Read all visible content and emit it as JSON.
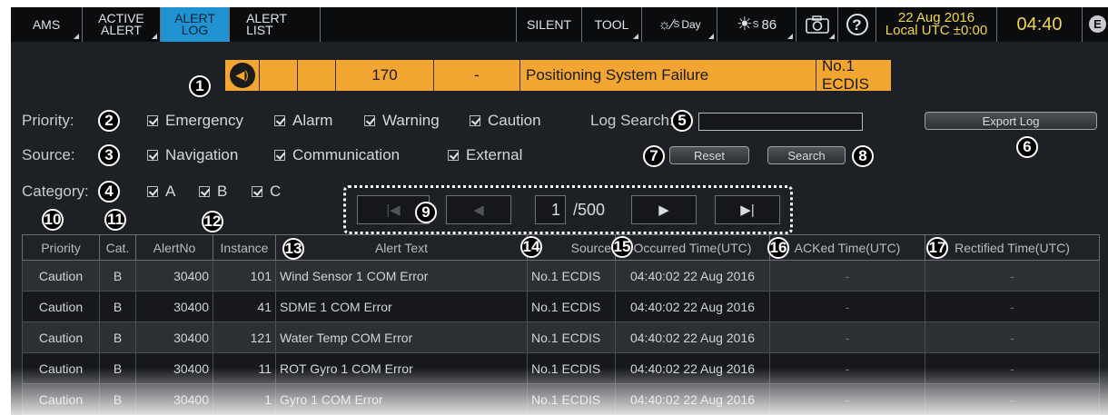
{
  "topbar": {
    "ams": "AMS",
    "active_alert_1": "ACTIVE",
    "active_alert_2": "ALERT",
    "alert_log_1": "ALERT",
    "alert_log_2": "LOG",
    "alert_list_1": "ALERT",
    "alert_list_2": "LIST",
    "silent": "SILENT",
    "tool": "TOOL",
    "day_mode": "Day",
    "day_sub": "S",
    "brightness": "86",
    "brightness_sub": "S",
    "date": "22 Aug 2016",
    "timezone": "Local UTC ±0:00",
    "time": "04:40",
    "emblem": "E",
    "accent_color": "#1e93cf",
    "time_color": "#f2d64b"
  },
  "latest_alert": {
    "alert_no": "170",
    "instance": "-",
    "text": "Positioning System Failure",
    "source": "No.1 ECDIS",
    "color": "#f2a531",
    "icon": "speaker-icon"
  },
  "filters": {
    "priority_label": "Priority:",
    "priority_options": [
      "Emergency",
      "Alarm",
      "Warning",
      "Caution"
    ],
    "source_label": "Source:",
    "source_options": [
      "Navigation",
      "Communication",
      "External"
    ],
    "category_label": "Category:",
    "category_options": [
      "A",
      "B",
      "C"
    ],
    "log_search_label": "Log Search:",
    "log_search_value": "",
    "export_button": "Export Log",
    "reset_button": "Reset",
    "search_button": "Search"
  },
  "pager": {
    "first": "|◀",
    "prev": "◀",
    "page": "1",
    "total": "/500",
    "next": "▶",
    "last": "▶|"
  },
  "table": {
    "headers": [
      "Priority",
      "Cat.",
      "AlertNo",
      "Instance",
      "Alert Text",
      "Source",
      "Occurred Time(UTC)",
      "ACKed Time(UTC)",
      "Rectified Time(UTC)"
    ],
    "rows": [
      [
        "Caution",
        "B",
        "30400",
        "101",
        "Wind Sensor 1 COM Error",
        "No.1 ECDIS",
        "04:40:02 22 Aug 2016",
        "-",
        "-"
      ],
      [
        "Caution",
        "B",
        "30400",
        "41",
        "SDME 1 COM Error",
        "No.1 ECDIS",
        "04:40:02 22 Aug 2016",
        "-",
        "-"
      ],
      [
        "Caution",
        "B",
        "30400",
        "121",
        "Water Temp COM Error",
        "No.1 ECDIS",
        "04:40:02 22 Aug 2016",
        "-",
        "-"
      ],
      [
        "Caution",
        "B",
        "30400",
        "11",
        "ROT Gyro 1 COM Error",
        "No.1 ECDIS",
        "04:40:02 22 Aug 2016",
        "-",
        "-"
      ],
      [
        "Caution",
        "B",
        "30400",
        "1",
        "Gyro 1 COM Error",
        "No.1 ECDIS",
        "04:40:02 22 Aug 2016",
        "-",
        "-"
      ]
    ]
  },
  "callouts": [
    "1",
    "2",
    "3",
    "4",
    "5",
    "6",
    "7",
    "8",
    "9",
    "10",
    "11",
    "12",
    "13",
    "14",
    "15",
    "16",
    "17"
  ]
}
